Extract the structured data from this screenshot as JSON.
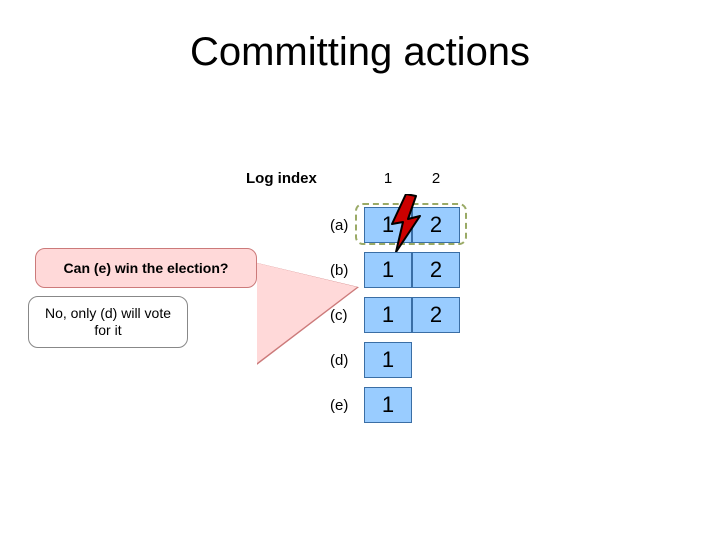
{
  "title": "Committing actions",
  "log_index_label": "Log index",
  "columns": {
    "c1": "1",
    "c2": "2"
  },
  "rows": {
    "a": {
      "label": "(a)",
      "c1": "1",
      "c2": "2"
    },
    "b": {
      "label": "(b)",
      "c1": "1",
      "c2": "2"
    },
    "c": {
      "label": "(c)",
      "c1": "1",
      "c2": "2"
    },
    "d": {
      "label": "(d)",
      "c1": "1"
    },
    "e": {
      "label": "(e)",
      "c1": "1"
    }
  },
  "callouts": {
    "question": "Can (e) win the election?",
    "answer": "No, only (d) will vote for it"
  },
  "chart_data": {
    "type": "table",
    "title": "Committing actions",
    "columns": [
      "Log index 1",
      "Log index 2"
    ],
    "rows": [
      {
        "name": "(a)",
        "values": [
          1,
          2
        ],
        "note": "crashed/failed (lightning), dashed highlight"
      },
      {
        "name": "(b)",
        "values": [
          1,
          2
        ]
      },
      {
        "name": "(c)",
        "values": [
          1,
          2
        ]
      },
      {
        "name": "(d)",
        "values": [
          1,
          null
        ]
      },
      {
        "name": "(e)",
        "values": [
          1,
          null
        ]
      }
    ],
    "annotations": [
      "Can (e) win the election?",
      "No, only (d) will vote for it"
    ]
  }
}
